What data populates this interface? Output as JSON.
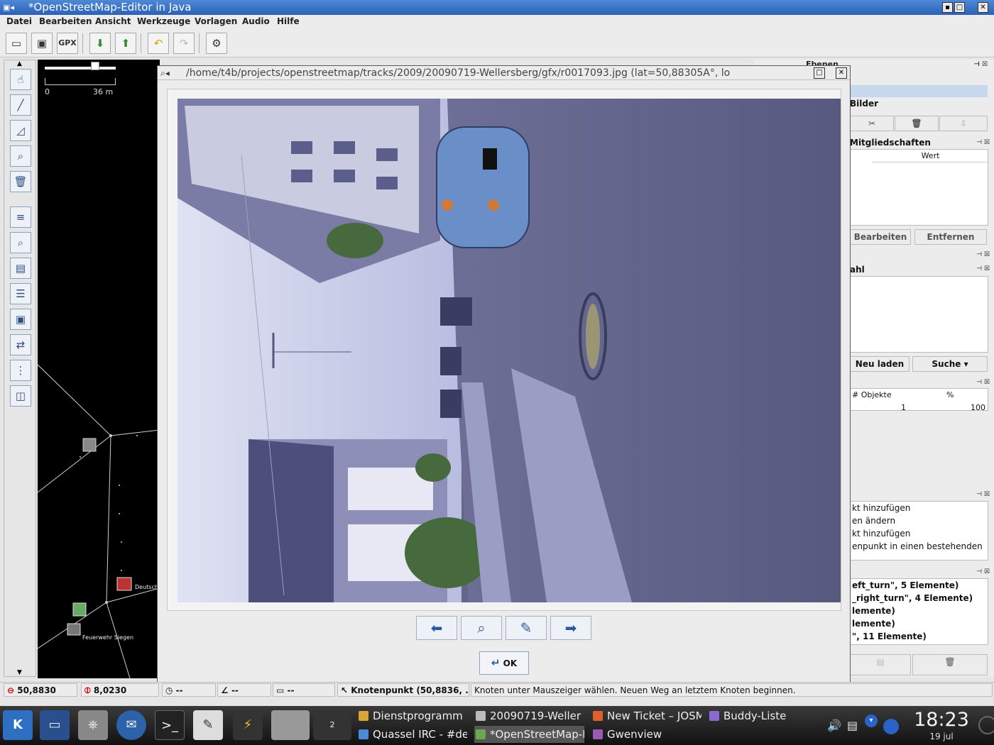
{
  "app": {
    "title": "*OpenStreetMap-Editor in Java"
  },
  "menu": [
    "Datei",
    "Bearbeiten",
    "Ansicht",
    "Werkzeuge",
    "Vorlagen",
    "Audio",
    "Hilfe"
  ],
  "toolbar": {
    "gpx_label": "GPX"
  },
  "map": {
    "scale_start": "0",
    "scale_end": "36 m",
    "labels": {
      "deutsch": "Deutsch",
      "feuerwehr": "Feuerwehr Siegen"
    }
  },
  "panels": {
    "ebenen_title": "Ebenen",
    "bilder_title": "Bilder",
    "mitglied_title": "Mitgliedschaften",
    "wert_header": "Wert",
    "bearbeiten_label": "Bearbeiten",
    "entfernen_label": "Entfernen",
    "auswahl_title": "ahl",
    "neu_laden_label": "Neu laden",
    "suche_label": "Suche",
    "objekte_header": "# Objekte",
    "percent_header": "%",
    "objekte_value": "1",
    "percent_value": "100",
    "history": [
      "kt hinzufügen",
      "en ändern",
      "kt hinzufügen",
      "enpunkt in einen bestehenden"
    ],
    "relations": [
      "eft_turn\", 5 Elemente)",
      "_right_turn\", 4 Elemente)",
      "lemente)",
      "lemente)",
      "\", 11 Elemente)"
    ]
  },
  "dialog": {
    "title": "/home/t4b/projects/openstreetmap/tracks/2009/20090719-Wellersberg/gfx/r0017093.jpg (lat=50,88305A°, lo",
    "ok_label": "OK"
  },
  "status": {
    "lat": "50,8830",
    "lon": "8,0230",
    "heading": "--",
    "angle": "--",
    "length": "--",
    "node": "Knotenpunkt (50,8836, ...",
    "hint": "Knoten unter Mauszeiger wählen. Neuen Weg an letztem Knoten beginnen."
  },
  "taskbar": {
    "tasks": [
      {
        "label": "Dienstprogramm",
        "color": "#d8a53a"
      },
      {
        "label": "20090719-Weller",
        "color": "#bbbbbb"
      },
      {
        "label": "New Ticket – JOSM",
        "color": "#e0602a"
      },
      {
        "label": "Buddy-Liste",
        "color": "#8a6ad0"
      },
      {
        "label": "Quassel IRC - #de",
        "color": "#4a8ad8"
      },
      {
        "label": "*OpenStreetMap-E",
        "color": "#6aa84f"
      },
      {
        "label": "Gwenview",
        "color": "#9b59b6"
      }
    ],
    "pager": "2",
    "time": "18:23",
    "date": "19 jul"
  }
}
